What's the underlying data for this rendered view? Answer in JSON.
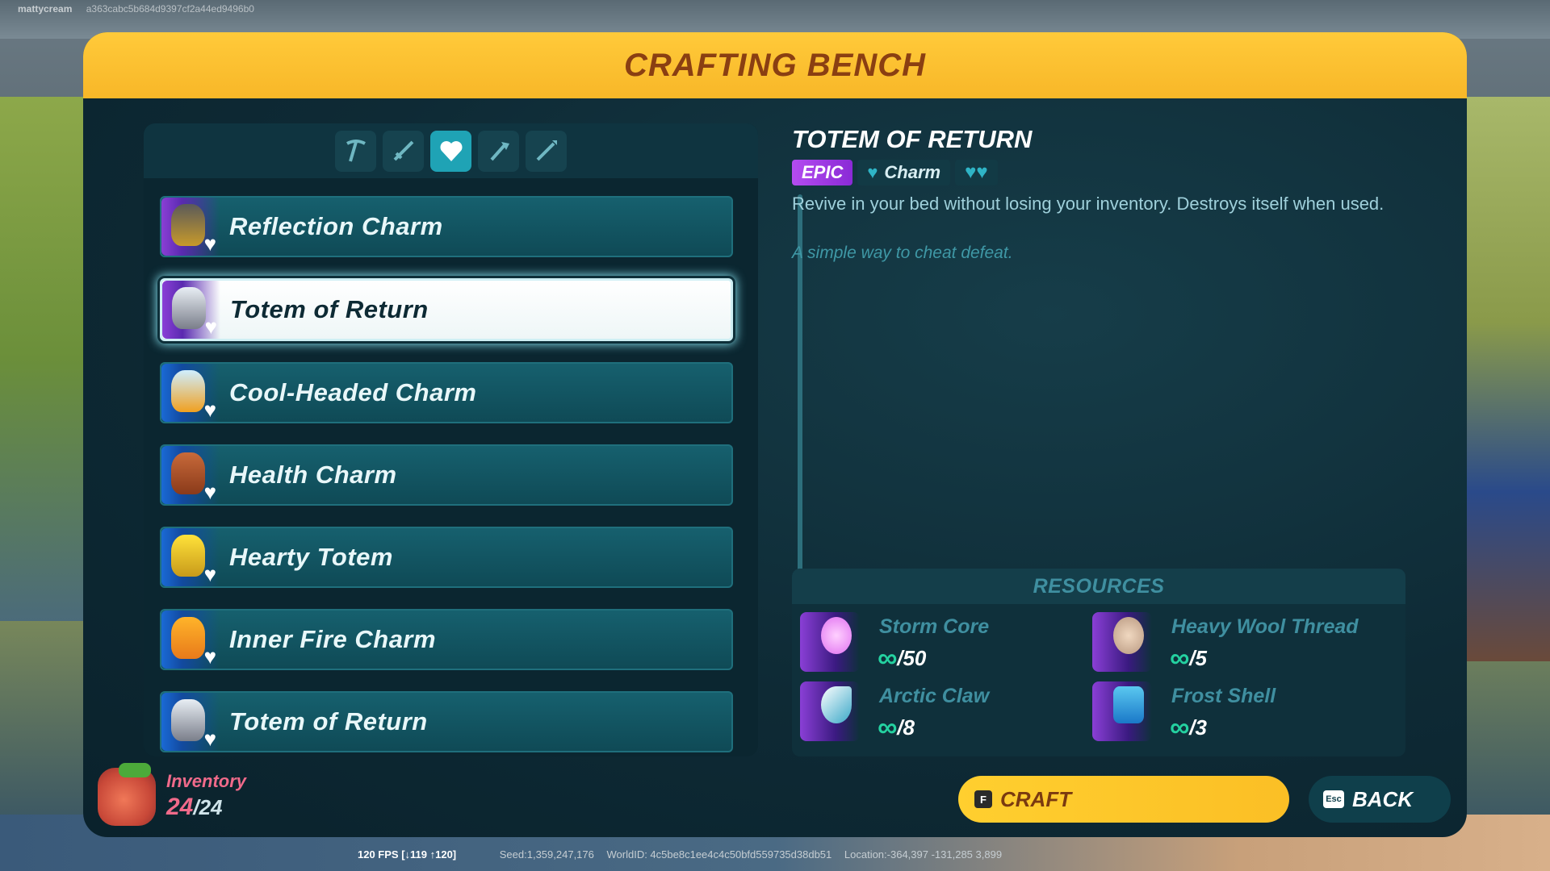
{
  "watermark": {
    "user": "mattycream",
    "hash": "a363cabc5b684d9397cf2a44ed9496b0"
  },
  "panel": {
    "title": "CRAFTING BENCH"
  },
  "tabs": [
    {
      "icon": "pickaxe-icon"
    },
    {
      "icon": "sword-icon"
    },
    {
      "icon": "heart-icon",
      "active": true
    },
    {
      "icon": "axe-icon"
    },
    {
      "icon": "spear-icon"
    }
  ],
  "items": [
    {
      "label": "Reflection Charm"
    },
    {
      "label": "Totem of Return"
    },
    {
      "label": "Cool-Headed Charm"
    },
    {
      "label": "Health Charm"
    },
    {
      "label": "Hearty Totem"
    },
    {
      "label": "Inner Fire Charm"
    },
    {
      "label": "Totem of Return"
    }
  ],
  "detail": {
    "title": "TOTEM OF RETURN",
    "rarity": "EPIC",
    "category": "Charm",
    "description": "Revive in your bed without losing your inventory. Destroys itself when used.",
    "flavor": "A simple way to cheat defeat."
  },
  "resources": {
    "heading": "RESOURCES",
    "items": [
      {
        "name": "Storm Core",
        "qty": "/50"
      },
      {
        "name": "Heavy Wool Thread",
        "qty": "/5"
      },
      {
        "name": "Arctic Claw",
        "qty": "/8"
      },
      {
        "name": "Frost Shell",
        "qty": "/3"
      }
    ]
  },
  "inventory": {
    "label": "Inventory",
    "count": "24",
    "max": "/24"
  },
  "actions": {
    "craft_key": "F",
    "craft_label": "CRAFT",
    "back_key": "Esc",
    "back_label": "BACK"
  },
  "footer": {
    "fps": "120 FPS [↓119 ↑120]",
    "seed": "Seed:1,359,247,176",
    "world": "WorldID: 4c5be8c1ee4c4c50bfd559735d38db51",
    "location": "Location:-364,397 -131,285 3,899"
  },
  "colors": {
    "header": "#ffca3a",
    "epic": "#b44cf0",
    "accent": "#1fa3b5",
    "craft": "#ffcf2f"
  }
}
